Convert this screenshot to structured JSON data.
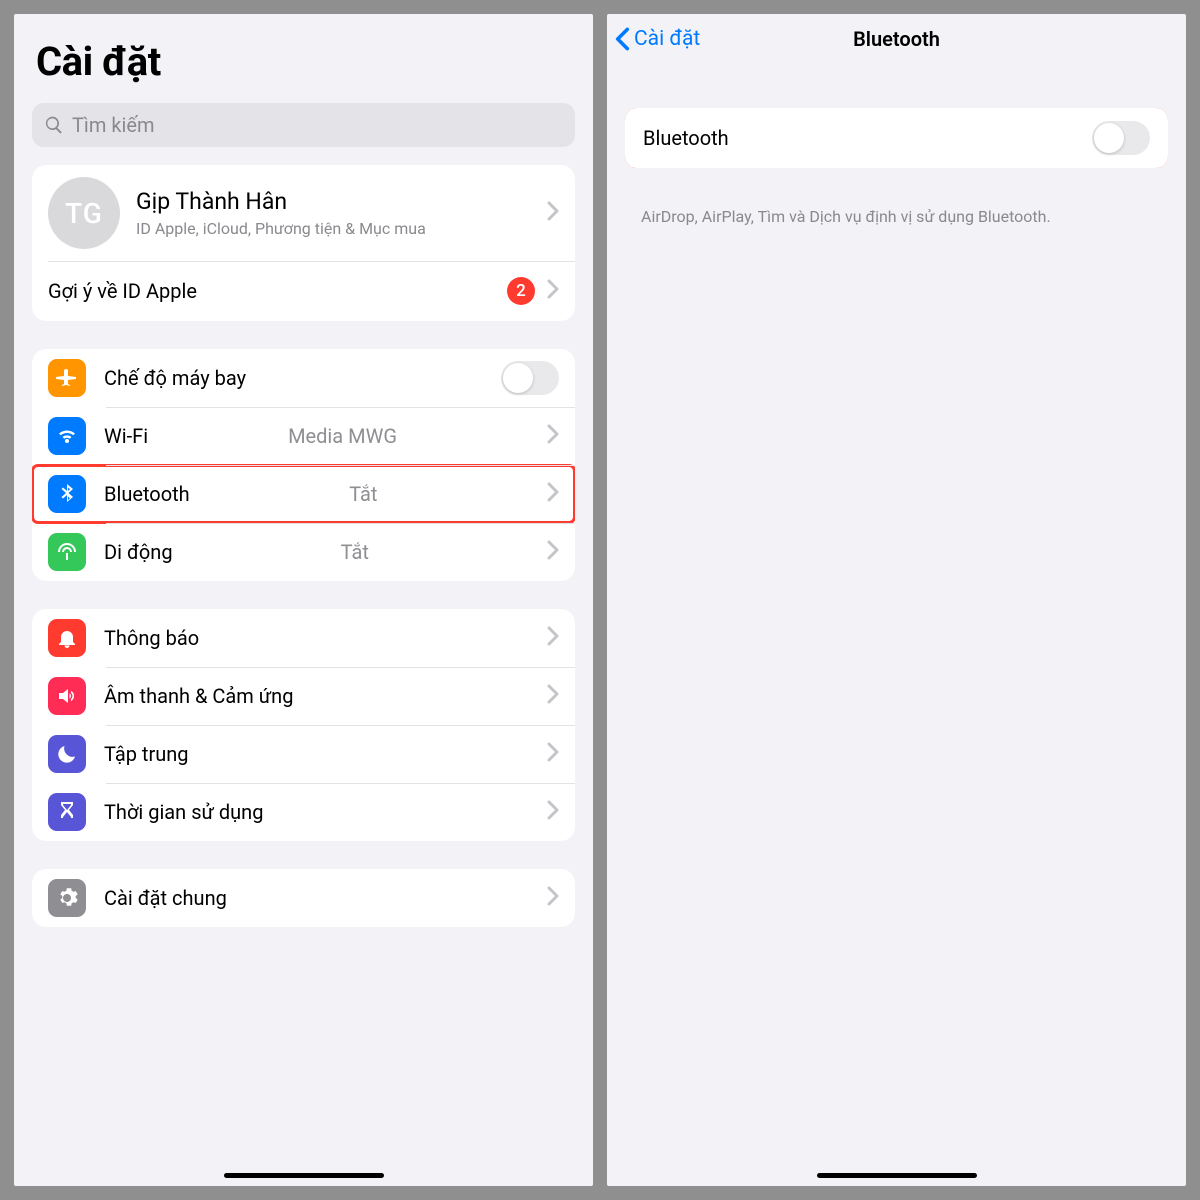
{
  "left": {
    "title": "Cài đặt",
    "search_placeholder": "Tìm kiếm",
    "profile": {
      "initials": "TG",
      "name": "Gịp Thành Hân",
      "sub": "ID Apple, iCloud, Phương tiện & Mục mua"
    },
    "appleid_suggestion": {
      "label": "Gợi ý về ID Apple",
      "badge": "2"
    },
    "group_connectivity": {
      "airplane": "Chế độ máy bay",
      "wifi": {
        "label": "Wi-Fi",
        "value": "Media MWG"
      },
      "bluetooth": {
        "label": "Bluetooth",
        "value": "Tắt"
      },
      "cellular": {
        "label": "Di động",
        "value": "Tắt"
      }
    },
    "group_notify": {
      "notifications": "Thông báo",
      "sounds": "Âm thanh & Cảm ứng",
      "focus": "Tập trung",
      "screentime": "Thời gian sử dụng"
    },
    "group_general": {
      "general": "Cài đặt chung"
    }
  },
  "right": {
    "back_label": "Cài đặt",
    "title": "Bluetooth",
    "toggle_label": "Bluetooth",
    "footer": "AirDrop, AirPlay, Tìm và Dịch vụ định vị sử dụng Bluetooth."
  }
}
